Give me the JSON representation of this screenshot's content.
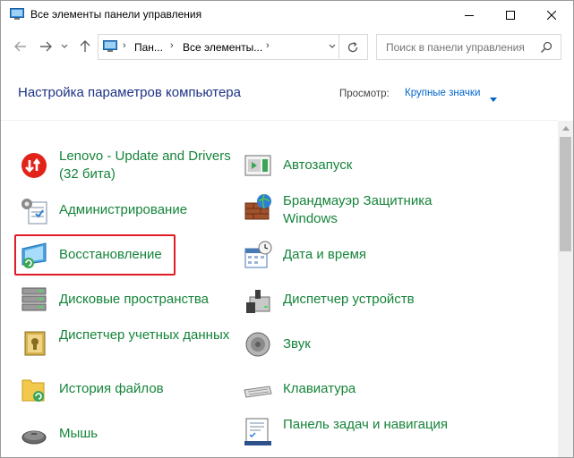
{
  "window": {
    "title": "Все элементы панели управления"
  },
  "address": {
    "crumbs": [
      "Пан...",
      "Все элементы..."
    ]
  },
  "search": {
    "placeholder": "Поиск в панели управления"
  },
  "header": {
    "title": "Настройка параметров компьютера",
    "view_label": "Просмотр:",
    "view_value": "Крупные значки"
  },
  "items": {
    "left": [
      {
        "label": "Lenovo - Update and Drivers (32 бита)",
        "icon": "lenovo-update-icon"
      },
      {
        "label": "Администрирование",
        "icon": "administration-icon"
      },
      {
        "label": "Восстановление",
        "icon": "recovery-icon"
      },
      {
        "label": "Дисковые пространства",
        "icon": "storage-spaces-icon"
      },
      {
        "label": "Диспетчер учетных данных",
        "icon": "credential-manager-icon"
      },
      {
        "label": "История файлов",
        "icon": "file-history-icon"
      },
      {
        "label": "Мышь",
        "icon": "mouse-icon"
      }
    ],
    "right": [
      {
        "label": "Автозапуск",
        "icon": "autoplay-icon"
      },
      {
        "label": "Брандмауэр Защитника Windows",
        "icon": "firewall-icon"
      },
      {
        "label": "Дата и время",
        "icon": "date-time-icon"
      },
      {
        "label": "Диспетчер устройств",
        "icon": "device-manager-icon"
      },
      {
        "label": "Звук",
        "icon": "sound-icon"
      },
      {
        "label": "Клавиатура",
        "icon": "keyboard-icon"
      },
      {
        "label": "Панель задач и навигация",
        "icon": "taskbar-icon"
      }
    ]
  },
  "highlight": {
    "target": "Восстановление",
    "color": "#e01b24"
  },
  "colors": {
    "item_text": "#15843a",
    "header_text": "#1e3287",
    "link": "#0066cc"
  }
}
